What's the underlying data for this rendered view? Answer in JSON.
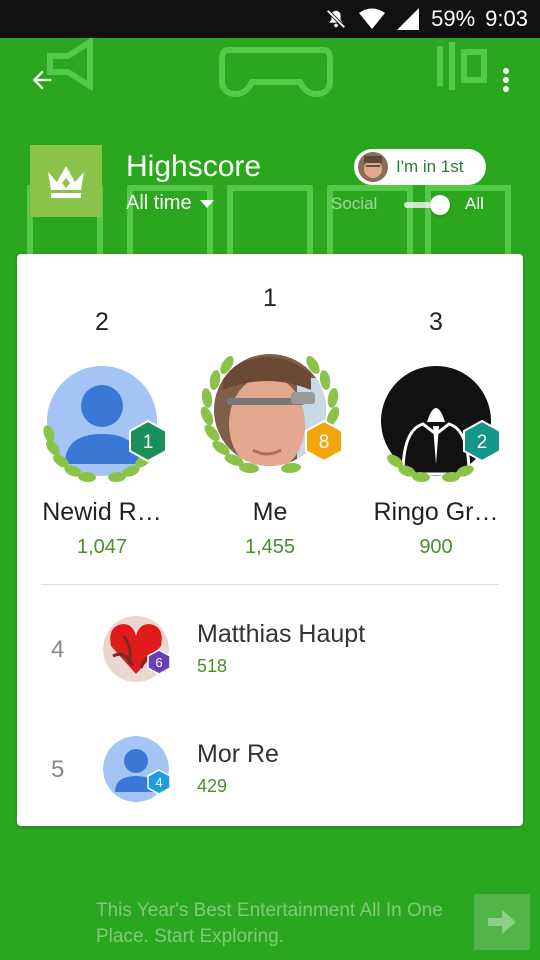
{
  "status_bar": {
    "battery": "59%",
    "time": "9:03",
    "icons": [
      "mute-icon",
      "wifi-icon",
      "signal-icon"
    ]
  },
  "header": {
    "title": "Highscore",
    "time_filter": "All time",
    "rank_pill": "I'm in 1st",
    "social_label": "Social",
    "all_label": "All",
    "toggle_state": "all"
  },
  "podium": [
    {
      "rank": "2",
      "name": "Newid R…",
      "score": "1,047",
      "level": "1",
      "level_color": "#1b8f5a"
    },
    {
      "rank": "1",
      "name": "Me",
      "score": "1,455",
      "level": "8",
      "level_color": "#f2a60c"
    },
    {
      "rank": "3",
      "name": "Ringo Gr…",
      "score": "900",
      "level": "2",
      "level_color": "#14958a"
    }
  ],
  "list": [
    {
      "rank": "4",
      "name": "Matthias Haupt",
      "score": "518",
      "level": "6",
      "level_color": "#6a3fb5"
    },
    {
      "rank": "5",
      "name": "Mor Re",
      "score": "429",
      "level": "4",
      "level_color": "#1e9be8"
    }
  ],
  "ad": {
    "text": "This Year's Best Entertainment All In One Place. Start Exploring."
  },
  "colors": {
    "background": "#2ba61f",
    "score": "#4a8f2a",
    "crown_tile": "#8bc34a",
    "laurel": "#8bc34a"
  }
}
